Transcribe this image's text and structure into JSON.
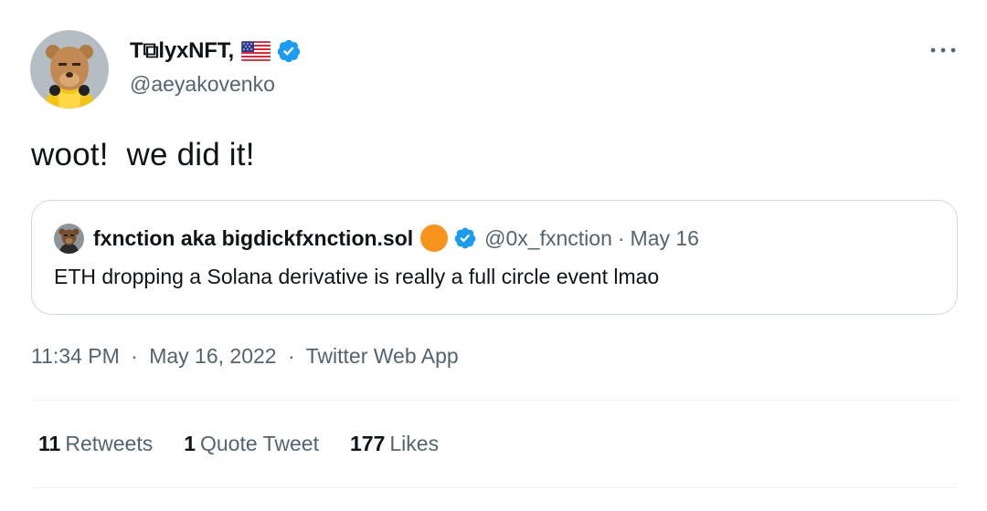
{
  "author": {
    "display_name": "T⧉lyxNFT,",
    "handle": "@aeyakovenko",
    "flag_icon": "us-flag-icon",
    "verified": true
  },
  "tweet": {
    "text": "woot!  we did it!"
  },
  "quote": {
    "display_name": "fxnction aka bigdickfxnction.sol",
    "badge_icon": "orange-circle-icon",
    "verified": true,
    "handle": "@0x_fxnction",
    "separator": "·",
    "date": "May 16",
    "text": "ETH dropping a Solana derivative is really a full circle event lmao"
  },
  "meta": {
    "time": "11:34 PM",
    "date": "May 16, 2022",
    "source": "Twitter Web App",
    "separator": "·"
  },
  "stats": {
    "retweets_count": "11",
    "retweets_label": "Retweets",
    "quotes_count": "1",
    "quotes_label": "Quote Tweet",
    "likes_count": "177",
    "likes_label": "Likes"
  },
  "colors": {
    "text": "#0f1419",
    "secondary": "#536471",
    "verified": "#1d9bf0",
    "border": "#cfd9de",
    "orange": "#f7941d"
  }
}
